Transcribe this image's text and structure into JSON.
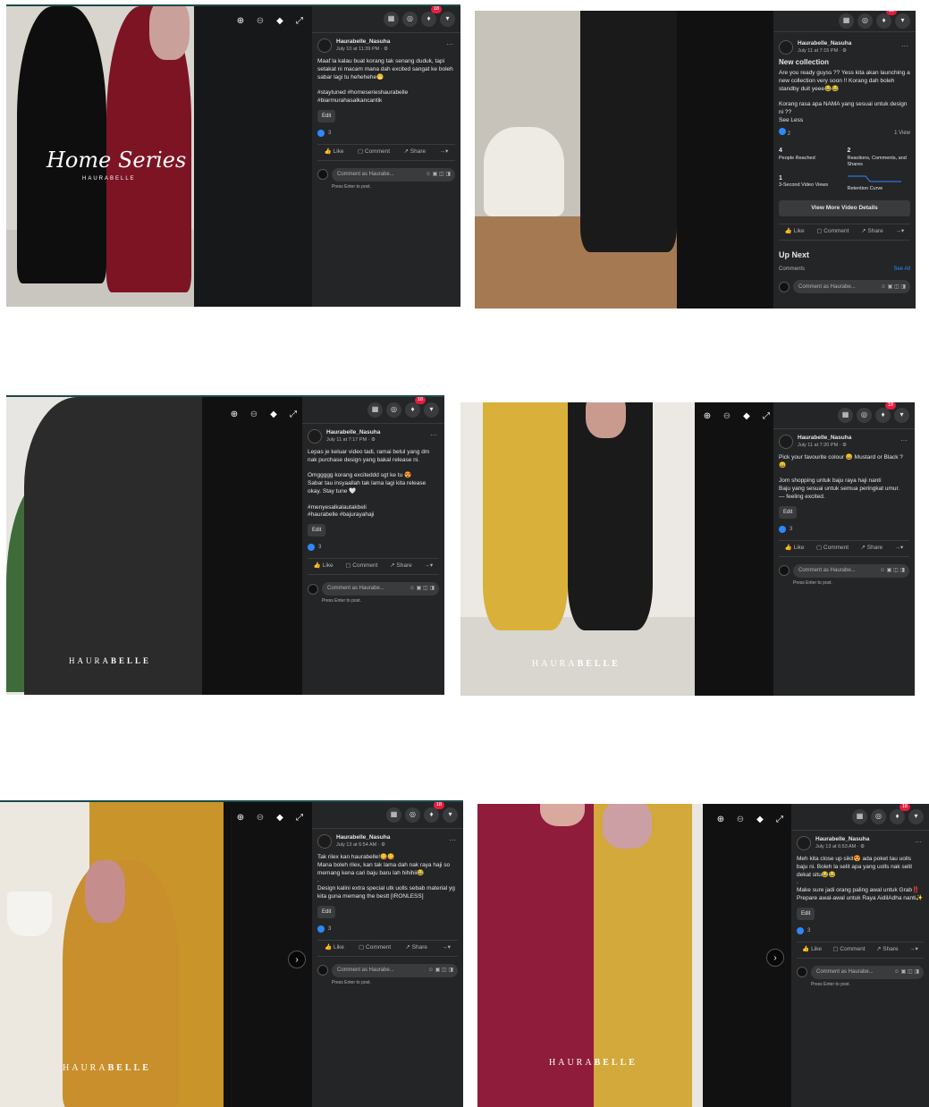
{
  "common": {
    "badge_count": "18",
    "author": "Haurabelle_Nasuha",
    "edit_label": "Edit",
    "like_label": "Like",
    "comment_label": "Comment",
    "share_label": "Share",
    "comment_placeholder": "Comment as Haurabe...",
    "press_enter": "Press Enter to post.",
    "brand_light": "HAURA",
    "brand_bold": "BELLE"
  },
  "shots": [
    {
      "date": "July 10 at 11:39 PM · ⚙",
      "text": "Maaf la kalau buat korang tak senang duduk, tapi setakat ni macam mana dah excited sangat ke boleh sabar lagi tu hehehehe😬\n\n#staytuned #homeserieshaurabelle\n#biarmurahasalkancantik",
      "reactions": "3",
      "overlay_title": "Home Series",
      "overlay_sub": "HAURABELLE"
    },
    {
      "date": "July 11 at 7:15 PM · ⚙",
      "headline": "New collection",
      "text": "Are you ready guyss ?? Yess kita akan launching a new collection very soon !! Korang dah boleh standby duit yeee😂😂\n\nKorang rasa apa NAMA yang sesuai untuk design ni ??",
      "see_less": "See Less",
      "reactions": "2",
      "views": "1 View",
      "stats": [
        {
          "value": "4",
          "label": "People Reached"
        },
        {
          "value": "2",
          "label": "Reactions, Comments, and Shares"
        },
        {
          "value": "1",
          "label": "3-Second Video Views"
        },
        {
          "value": "",
          "label": "Retention Curve"
        }
      ],
      "video_details": "View More Video Details",
      "up_next": "Up Next",
      "comments_label": "Comments",
      "see_all": "See All"
    },
    {
      "date": "July 11 at 7:17 PM · ⚙",
      "text": "Lepas je keluar video tadi, ramai betul yang dm nak purchase design yang bakal release ni.\n\nOmggggg korang exciteddd sgt ke tu 😍\nSabar tau insyaallah tak lama lagi kita release okay. Stay tune 🤍\n\n#menyesalkalautakbeli\n#haurabelle #bajurayahaji",
      "reactions": "3"
    },
    {
      "date": "July 11 at 7:20 PM · ⚙",
      "text": "Pick your favourite colour 😄 Mustard or Black ?😄\n\nJom shopping untuk baju raya haji nanti\nBaju yang sesuai untuk semua peringkat umur.\n— feeling excited.",
      "reactions": "3"
    },
    {
      "date": "July 13 at 6:54 AM · ⚙",
      "text": "Tak rilex kan haurabelle!😋😋\nMana boleh rilex, kan tak lama dah nak raya haji so memang kena cari baju baru lah hihihii😂\n.\nDesign kalini extra special utk uolls sebab material yg kita guna memang the bestt [IRONLESS]",
      "reactions": "3"
    },
    {
      "date": "July 13 at 6:53 AM · ⚙",
      "text": "Meh kita close up sikit😍 ada poket tau uolls baju ni. Boleh la selit apa yang uolls nak selit dekat situ😂😂\n.\nMake sure jadi orang paling awal untuk Grab‼️\nPrepare awal-awal untuk Raya AidilAdha nanti✨",
      "reactions": "3"
    }
  ],
  "icons": {
    "grid": "menu-grid-icon",
    "messenger": "messenger-icon",
    "bell": "notifications-icon",
    "caret": "account-caret-icon"
  }
}
